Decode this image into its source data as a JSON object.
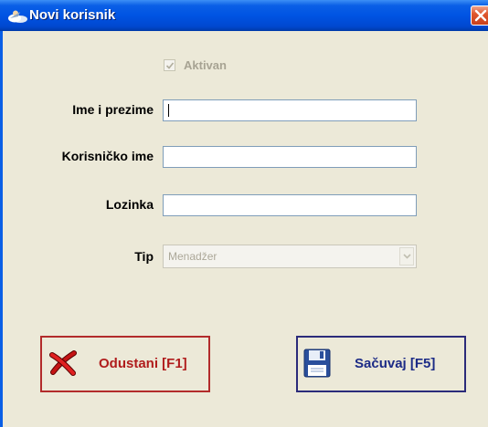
{
  "window": {
    "title": "Novi korisnik",
    "title_icon": "users-icon",
    "close_icon": "close-icon"
  },
  "form": {
    "active": {
      "label": "Aktivan",
      "checked": true,
      "enabled": false
    },
    "full_name": {
      "label": "Ime i prezime",
      "value": ""
    },
    "username": {
      "label": "Korisničko ime",
      "value": ""
    },
    "password": {
      "label": "Lozinka",
      "value": ""
    },
    "type": {
      "label": "Tip",
      "selected": "Menadžer",
      "enabled": false
    }
  },
  "buttons": {
    "cancel": {
      "label": "Odustani [F1]",
      "icon": "x-cancel-icon",
      "color": "#b22b2b"
    },
    "save": {
      "label": "Sačuvaj [F5]",
      "icon": "floppy-disk-icon",
      "color": "#2b2b7a"
    }
  },
  "colors": {
    "titlebar": "#0054e3",
    "window_bg": "#ece9d8",
    "cancel_text": "#b01c1c",
    "save_text": "#1c2b86"
  }
}
